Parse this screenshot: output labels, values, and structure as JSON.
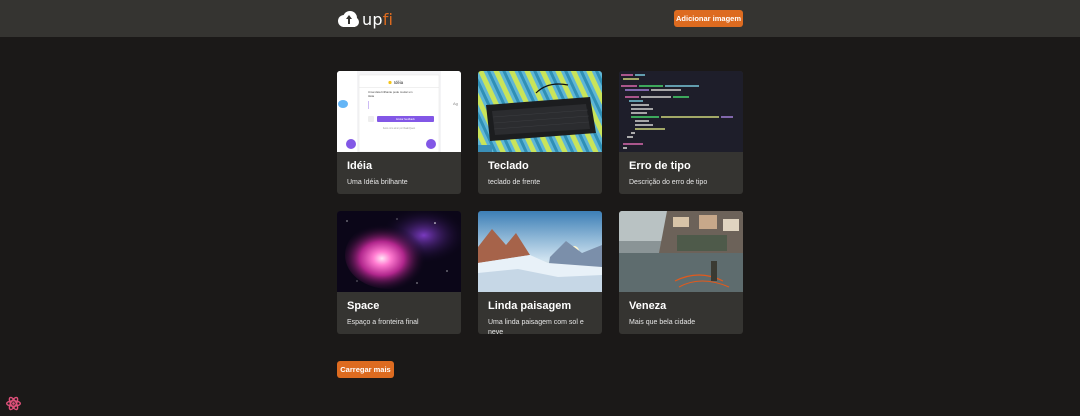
{
  "header": {
    "logo_text_main": "up",
    "logo_text_accent": "fi",
    "add_button_label": "Adicionar imagem"
  },
  "cards": [
    {
      "title": "Idéia",
      "description": "Uma Idéia brilhante",
      "image": "screenshot-of-idea-modal",
      "thumb_text": {
        "modal_title": "Idéia",
        "line1": "Uma idéia brilhante pode mudar um",
        "line2": "Idéia",
        "button": "Enviar feedback",
        "footer": "Feito com amor por RaabQuest"
      }
    },
    {
      "title": "Teclado",
      "description": "teclado de frente",
      "image": "photo-of-black-keyboard"
    },
    {
      "title": "Erro de tipo",
      "description": "Descrição do erro de tipo",
      "image": "screenshot-of-code-editor"
    },
    {
      "title": "Space",
      "description": "Espaço a fronteira final",
      "image": "photo-of-nebula"
    },
    {
      "title": "Linda paisagem",
      "description": "Uma linda paisagem com sol e neve",
      "image": "photo-of-snowy-mountains"
    },
    {
      "title": "Veneza",
      "description": "Mais que bela cidade",
      "image": "photo-of-lakeside-town"
    }
  ],
  "load_more_label": "Carregar mais",
  "colors": {
    "accent": "#dd6b20",
    "background": "#1b1918",
    "header": "#353431",
    "card": "#353431"
  },
  "icons": {
    "logo": "cloud-upload-icon",
    "devtools": "react-icon"
  }
}
